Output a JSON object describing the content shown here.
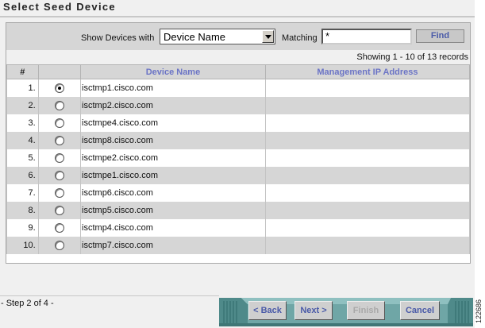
{
  "window": {
    "title": "Select Seed Device"
  },
  "filter": {
    "show_label": "Show Devices with",
    "select_value": "Device Name",
    "matching_label": "Matching",
    "matching_value": "*",
    "find_label": "Find"
  },
  "pagination": {
    "showing": "Showing 1 - 10 of 13 records"
  },
  "table": {
    "columns": {
      "num": "#",
      "select": "",
      "device_name": "Device Name",
      "ip": "Management IP Address"
    },
    "rows": [
      {
        "num": "1.",
        "device": "isctmp1.cisco.com",
        "ip": "",
        "selected": true
      },
      {
        "num": "2.",
        "device": "isctmp2.cisco.com",
        "ip": "",
        "selected": false
      },
      {
        "num": "3.",
        "device": "isctmpe4.cisco.com",
        "ip": "",
        "selected": false
      },
      {
        "num": "4.",
        "device": "isctmp8.cisco.com",
        "ip": "",
        "selected": false
      },
      {
        "num": "5.",
        "device": "isctmpe2.cisco.com",
        "ip": "",
        "selected": false
      },
      {
        "num": "6.",
        "device": "isctmpe1.cisco.com",
        "ip": "",
        "selected": false
      },
      {
        "num": "7.",
        "device": "isctmp6.cisco.com",
        "ip": "",
        "selected": false
      },
      {
        "num": "8.",
        "device": "isctmp5.cisco.com",
        "ip": "",
        "selected": false
      },
      {
        "num": "9.",
        "device": "isctmp4.cisco.com",
        "ip": "",
        "selected": false
      },
      {
        "num": "10.",
        "device": "isctmp7.cisco.com",
        "ip": "",
        "selected": false
      }
    ]
  },
  "wizard": {
    "step": "- Step 2 of 4 -",
    "back_label": "< Back",
    "next_label": "Next >",
    "finish_label": "Finish",
    "cancel_label": "Cancel"
  },
  "figure_number": "122686",
  "colors": {
    "nav_teal": "#6fa6a6",
    "link_blue": "#4a5aa8",
    "row_alt": "#d6d6d6"
  }
}
